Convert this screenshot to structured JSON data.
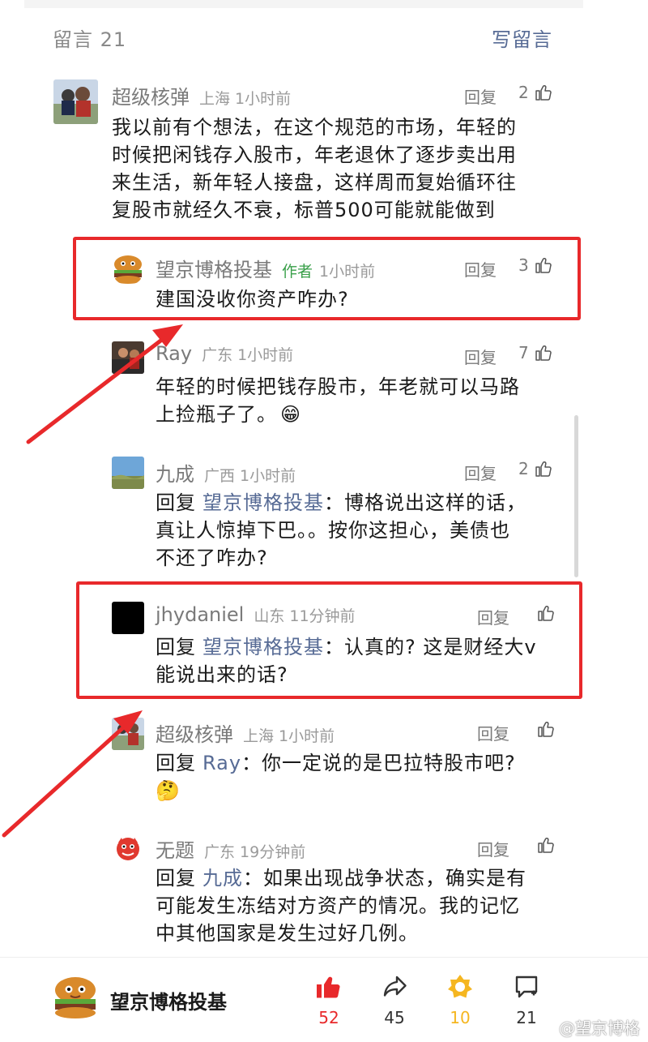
{
  "header": {
    "count_label": "留言 21",
    "write_label": "写留言"
  },
  "comments": [
    {
      "name": "超级核弹",
      "location": "上海",
      "time": "1小时前",
      "reply_label": "回复",
      "likes": "2",
      "lines": [
        "我以前有个想法，在这个规范的市场，年轻的",
        "时候把闲钱存入股市，年老退休了逐步卖出用",
        "来生活，新年轻人接盘，这样周而复始循环往",
        "复股市就经久不衰，标普500可能就能做到"
      ]
    },
    {
      "name": "望京博格投基",
      "author_tag": "作者",
      "time": "1小时前",
      "reply_label": "回复",
      "likes": "3",
      "lines": [
        "建国没收你资产咋办?"
      ]
    },
    {
      "name": "Ray",
      "location": "广东",
      "time": "1小时前",
      "reply_label": "回复",
      "likes": "7",
      "lines": [
        "年轻的时候把钱存股市，年老就可以马路",
        "上捡瓶子了。"
      ],
      "emoji": "😁"
    },
    {
      "name": "九成",
      "location": "广西",
      "time": "1小时前",
      "reply_label": "回复",
      "likes": "2",
      "reply_prefix": "回复",
      "reply_to": "望京博格投基",
      "lines": [
        "：博格说出这样的话，",
        "真让人惊掉下巴。。按你这担心，美债也",
        "不还了咋办?"
      ]
    },
    {
      "name": "jhydaniel",
      "location": "山东",
      "time": "11分钟前",
      "reply_label": "回复",
      "likes": "",
      "reply_prefix": "回复",
      "reply_to": "望京博格投基",
      "lines": [
        "：认真的? 这是财经大v",
        "能说出来的话?"
      ]
    },
    {
      "name": "超级核弹",
      "location": "上海",
      "time": "1小时前",
      "reply_label": "回复",
      "likes": "",
      "reply_prefix": "回复",
      "reply_to": "Ray",
      "lines": [
        "：你一定说的是巴拉特股市吧?"
      ],
      "emoji": "🤔"
    },
    {
      "name": "无题",
      "location": "广东",
      "time": "19分钟前",
      "reply_label": "回复",
      "likes": "",
      "reply_prefix": "回复",
      "reply_to": "九成",
      "lines": [
        "：如果出现战争状态，确实是有",
        "可能发生冻结对方资产的情况。我的记忆",
        "中其他国家是发生过好几例。"
      ]
    }
  ],
  "bottom_bar": {
    "account_name": "望京博格投基",
    "like_count": "52",
    "share_count": "45",
    "favorite_count": "10",
    "comment_count": "21"
  },
  "watermark": "@望京博格",
  "colors": {
    "link": "#576b95",
    "author_tag": "#3aa04a",
    "highlight_box": "#e8292b",
    "like_active": "#e8292b",
    "favorite": "#f5b620"
  }
}
